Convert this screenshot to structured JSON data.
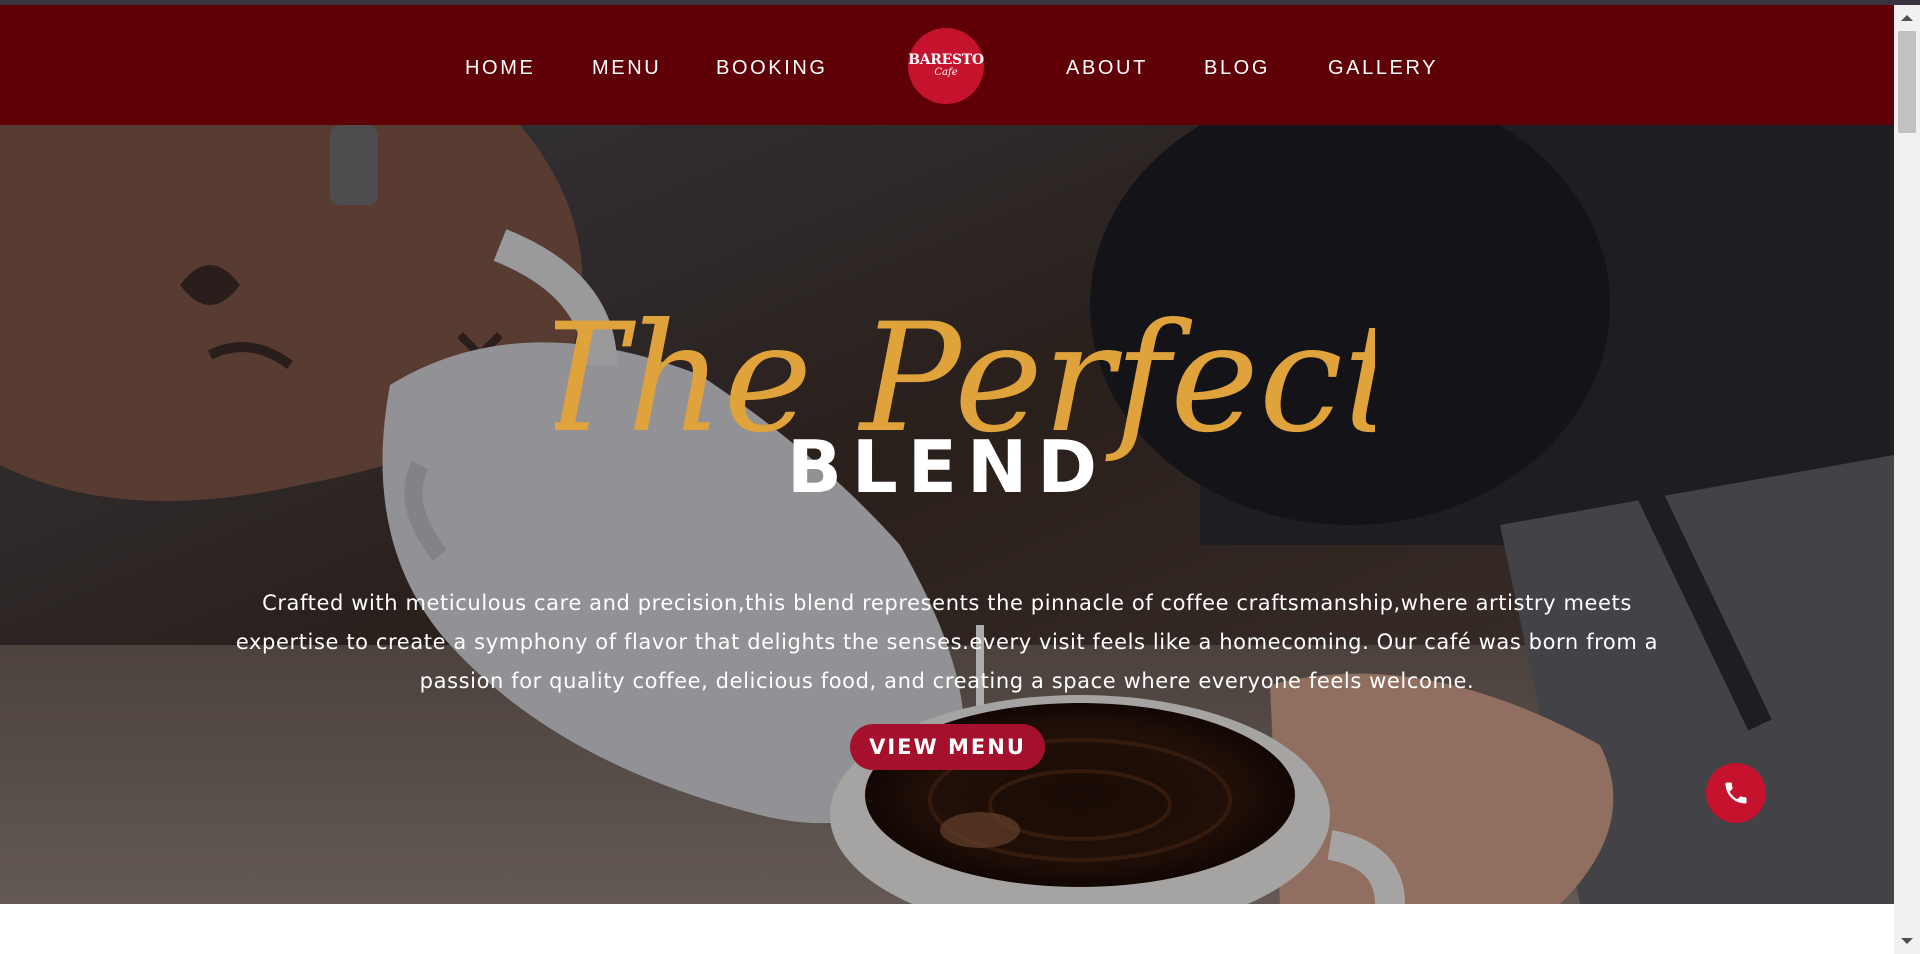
{
  "nav": {
    "left_links": [
      "HOME",
      "MENU",
      "BOOKING"
    ],
    "right_links": [
      "ABOUT",
      "BLOG",
      "GALLERY"
    ],
    "logo": {
      "name": "BARESTO",
      "sub": "Cafe"
    }
  },
  "hero": {
    "script_title": "The Perfect",
    "title": "BLEND",
    "description": "Crafted with meticulous care and precision,this blend represents the pinnacle of coffee craftsmanship,where artistry meets expertise to create a symphony of flavor that delights the senses.every visit feels like a homecoming. Our café was born from a passion for quality coffee, delicious food, and creating a space where everyone feels welcome.",
    "cta": "VIEW MENU",
    "call_icon": "phone-icon"
  },
  "colors": {
    "navbar": "#5e0006",
    "accent": "#c5122d",
    "button": "#a5112c",
    "script": "#e0a23a"
  }
}
